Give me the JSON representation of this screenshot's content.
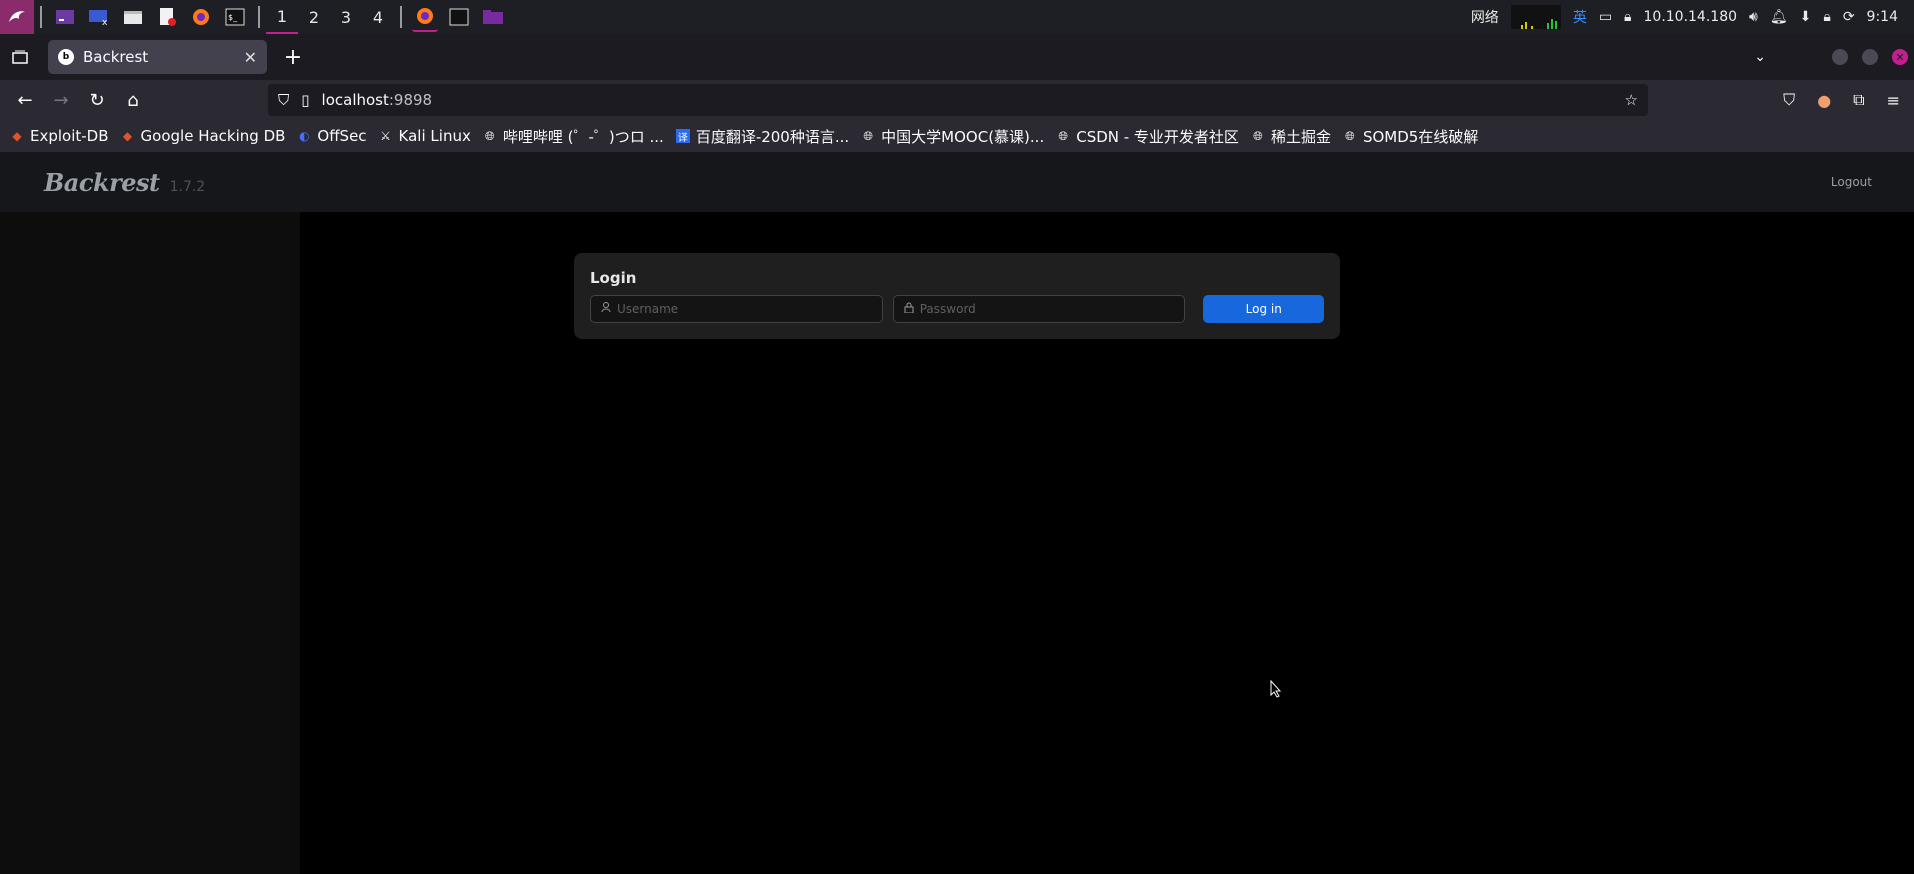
{
  "taskbar": {
    "workspaces": [
      "1",
      "2",
      "3",
      "4"
    ],
    "active_workspace": "1",
    "network_label": "网络",
    "ime_label": "英",
    "ip": "10.10.14.180",
    "clock": "9:14"
  },
  "browser": {
    "tab_title": "Backrest",
    "url_host": "localhost",
    "url_port": ":9898"
  },
  "bookmarks": [
    {
      "label": "Exploit-DB",
      "icon": "exploit-db-icon"
    },
    {
      "label": "Google Hacking DB",
      "icon": "ghdb-icon"
    },
    {
      "label": "OffSec",
      "icon": "offsec-icon"
    },
    {
      "label": "Kali Linux",
      "icon": "kali-icon"
    },
    {
      "label": "哔哩哔哩 (゜-゜)つロ ...",
      "icon": "globe-icon"
    },
    {
      "label": "百度翻译-200种语言...",
      "icon": "baidu-translate-icon"
    },
    {
      "label": "中国大学MOOC(慕课)...",
      "icon": "globe-icon"
    },
    {
      "label": "CSDN - 专业开发者社区",
      "icon": "globe-icon"
    },
    {
      "label": "稀土掘金",
      "icon": "globe-icon"
    },
    {
      "label": "SOMD5在线破解",
      "icon": "globe-icon"
    }
  ],
  "app": {
    "logo_text": "Backrest",
    "version": "1.7.2",
    "logout_label": "Logout",
    "login": {
      "title": "Login",
      "username_placeholder": "Username",
      "password_placeholder": "Password",
      "submit_label": "Log in"
    }
  },
  "colors": {
    "accent_button": "#1668dc",
    "taskbar_accent": "#c51f8d"
  }
}
